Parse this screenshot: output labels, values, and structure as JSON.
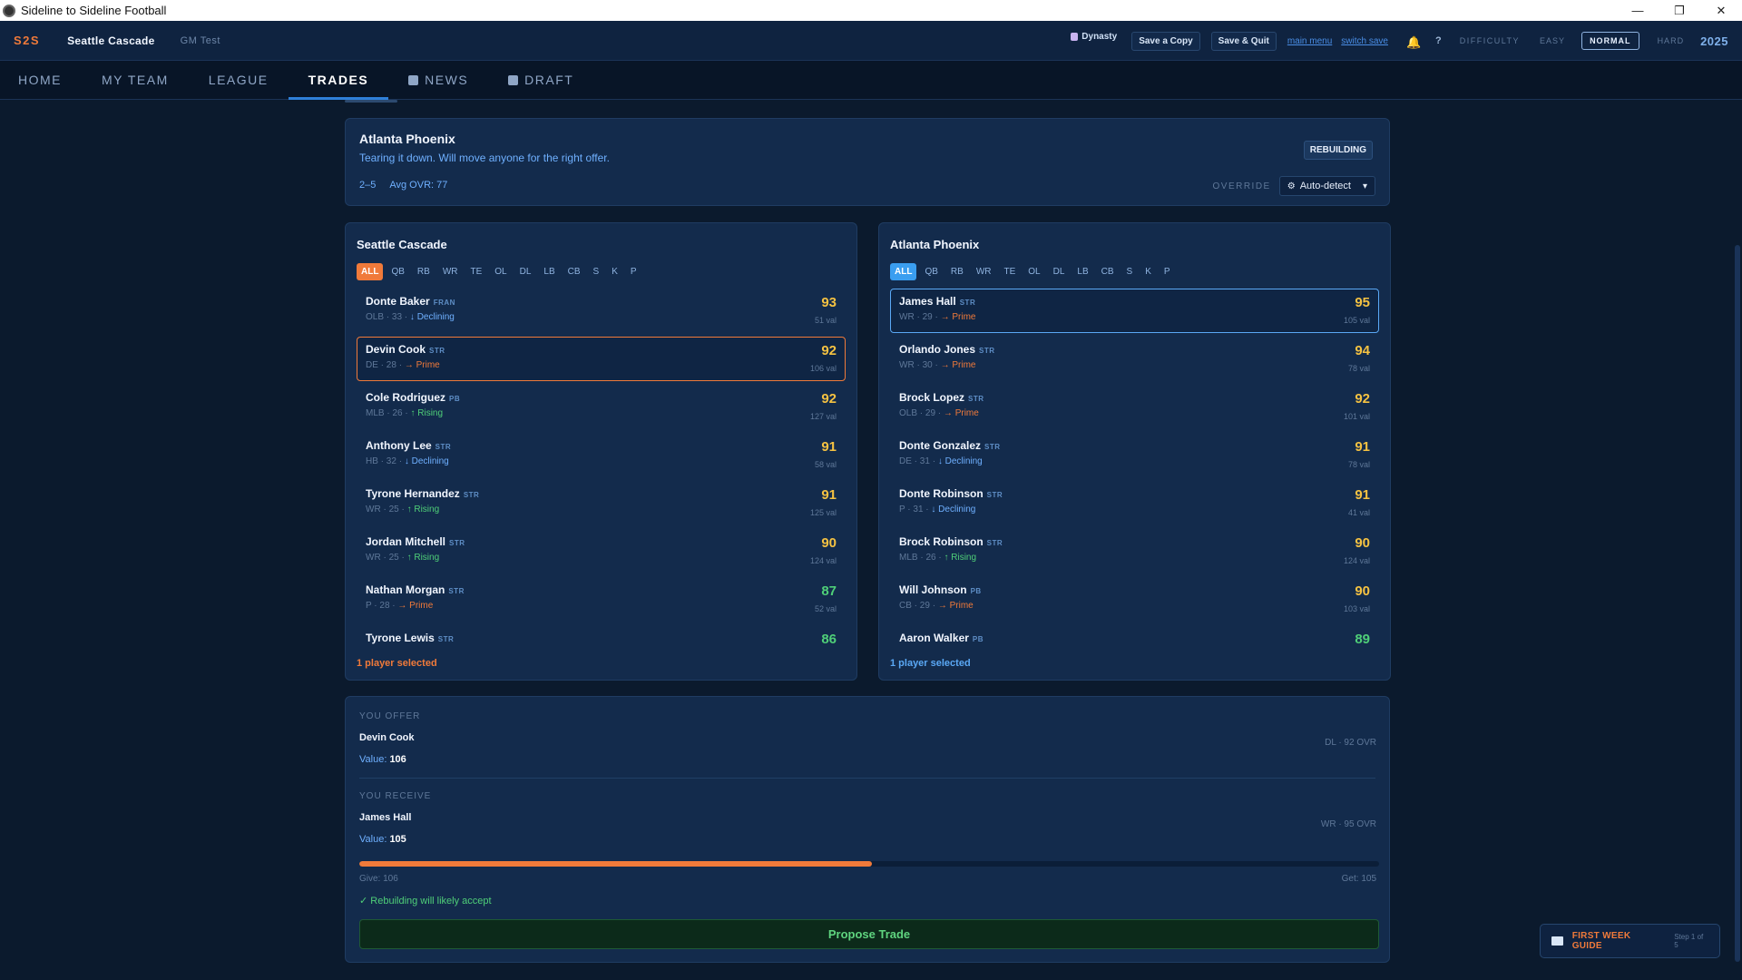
{
  "window": {
    "title": "Sideline to Sideline Football",
    "controls": [
      "—",
      "❐",
      "✕"
    ]
  },
  "header": {
    "logo": "S2S",
    "team": "Seattle Cascade",
    "gm": "GM Test",
    "dynasty_label": "Dynasty",
    "save_copy": "Save a Copy",
    "save_quit": "Save & Quit",
    "main_menu": "main menu",
    "switch_save": "switch save",
    "help": "?",
    "difficulty_label": "DIFFICULTY",
    "difficulty_options": [
      "EASY",
      "NORMAL",
      "HARD"
    ],
    "difficulty_selected": "NORMAL",
    "season": "2025"
  },
  "nav": {
    "items": [
      "HOME",
      "MY TEAM",
      "LEAGUE",
      "TRADES",
      "NEWS",
      "DRAFT"
    ],
    "active": "TRADES"
  },
  "partner": {
    "name": "Atlanta Phoenix",
    "motto": "Tearing it down. Will move anyone for the right offer.",
    "record": "2–5",
    "avg_ovr": "Avg OVR: 77",
    "status": "REBUILDING",
    "override_label": "OVERRIDE",
    "override_value": "Auto-detect"
  },
  "positions": [
    "ALL",
    "QB",
    "RB",
    "WR",
    "TE",
    "OL",
    "DL",
    "LB",
    "CB",
    "S",
    "K",
    "P"
  ],
  "left_roster": {
    "title": "Seattle Cascade",
    "selected_text": "1 player selected",
    "players": [
      {
        "name": "Donte Baker",
        "tag": "FRAN",
        "pos": "OLB",
        "age": "33",
        "trend": "↓ Declining",
        "trend_type": "decl",
        "ovr": "93",
        "val": "51 val",
        "ovr_color": "y"
      },
      {
        "name": "Devin Cook",
        "tag": "STR",
        "pos": "DE",
        "age": "28",
        "trend": "→ Prime",
        "trend_type": "prime",
        "ovr": "92",
        "val": "106 val",
        "ovr_color": "y",
        "selected": true
      },
      {
        "name": "Cole Rodriguez",
        "tag": "PB",
        "pos": "MLB",
        "age": "26",
        "trend": "↑ Rising",
        "trend_type": "rise",
        "ovr": "92",
        "val": "127 val",
        "ovr_color": "y"
      },
      {
        "name": "Anthony Lee",
        "tag": "STR",
        "pos": "HB",
        "age": "32",
        "trend": "↓ Declining",
        "trend_type": "decl",
        "ovr": "91",
        "val": "58 val",
        "ovr_color": "y"
      },
      {
        "name": "Tyrone Hernandez",
        "tag": "STR",
        "pos": "WR",
        "age": "25",
        "trend": "↑ Rising",
        "trend_type": "rise",
        "ovr": "91",
        "val": "125 val",
        "ovr_color": "y"
      },
      {
        "name": "Jordan Mitchell",
        "tag": "STR",
        "pos": "WR",
        "age": "25",
        "trend": "↑ Rising",
        "trend_type": "rise",
        "ovr": "90",
        "val": "124 val",
        "ovr_color": "y"
      },
      {
        "name": "Nathan Morgan",
        "tag": "STR",
        "pos": "P",
        "age": "28",
        "trend": "→ Prime",
        "trend_type": "prime",
        "ovr": "87",
        "val": "52 val",
        "ovr_color": "g"
      },
      {
        "name": "Tyrone Lewis",
        "tag": "STR",
        "pos": "",
        "age": "",
        "trend": "",
        "trend_type": "",
        "ovr": "86",
        "val": "",
        "ovr_color": "g"
      }
    ]
  },
  "right_roster": {
    "title": "Atlanta Phoenix",
    "selected_text": "1 player selected",
    "players": [
      {
        "name": "James Hall",
        "tag": "STR",
        "pos": "WR",
        "age": "29",
        "trend": "→ Prime",
        "trend_type": "prime",
        "ovr": "95",
        "val": "105 val",
        "ovr_color": "y",
        "selected": true
      },
      {
        "name": "Orlando Jones",
        "tag": "STR",
        "pos": "WR",
        "age": "30",
        "trend": "→ Prime",
        "trend_type": "prime",
        "ovr": "94",
        "val": "78 val",
        "ovr_color": "y"
      },
      {
        "name": "Brock Lopez",
        "tag": "STR",
        "pos": "OLB",
        "age": "29",
        "trend": "→ Prime",
        "trend_type": "prime",
        "ovr": "92",
        "val": "101 val",
        "ovr_color": "y"
      },
      {
        "name": "Donte Gonzalez",
        "tag": "STR",
        "pos": "DE",
        "age": "31",
        "trend": "↓ Declining",
        "trend_type": "decl",
        "ovr": "91",
        "val": "78 val",
        "ovr_color": "y"
      },
      {
        "name": "Donte Robinson",
        "tag": "STR",
        "pos": "P",
        "age": "31",
        "trend": "↓ Declining",
        "trend_type": "decl",
        "ovr": "91",
        "val": "41 val",
        "ovr_color": "y"
      },
      {
        "name": "Brock Robinson",
        "tag": "STR",
        "pos": "MLB",
        "age": "26",
        "trend": "↑ Rising",
        "trend_type": "rise",
        "ovr": "90",
        "val": "124 val",
        "ovr_color": "y"
      },
      {
        "name": "Will Johnson",
        "tag": "PB",
        "pos": "CB",
        "age": "29",
        "trend": "→ Prime",
        "trend_type": "prime",
        "ovr": "90",
        "val": "103 val",
        "ovr_color": "y"
      },
      {
        "name": "Aaron Walker",
        "tag": "PB",
        "pos": "",
        "age": "",
        "trend": "",
        "trend_type": "",
        "ovr": "89",
        "val": "",
        "ovr_color": "g"
      }
    ]
  },
  "summary": {
    "offer_label": "YOU OFFER",
    "offer_name": "Devin Cook",
    "offer_value_label": "Value:",
    "offer_value": "106",
    "offer_info": "DL · 92 OVR",
    "receive_label": "YOU RECEIVE",
    "receive_name": "James Hall",
    "receive_value_label": "Value:",
    "receive_value": "105",
    "receive_info": "WR · 95 OVR",
    "balance_fraction": 0.503,
    "give_label": "Give: 106",
    "get_label": "Get: 105",
    "verdict": "✓ Rebuilding will likely accept",
    "propose": "Propose Trade"
  },
  "guide": {
    "title": "FIRST WEEK GUIDE",
    "step": "Step 1 of 5"
  },
  "colors": {
    "accent_orange": "#f07a3a",
    "accent_blue": "#3a9ef0",
    "ovr_gold": "#f5c242",
    "ovr_green": "#4fcf78"
  }
}
